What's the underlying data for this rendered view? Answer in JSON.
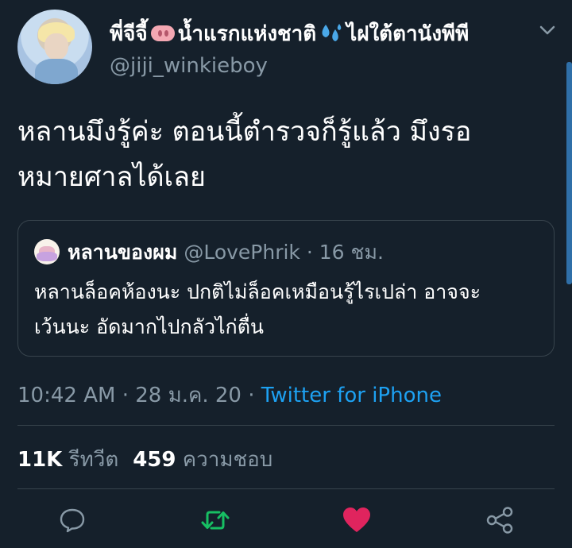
{
  "author": {
    "name_part1": "พี่จีจี้",
    "name_part2": "น้ำแรกแห่งชาติ",
    "name_part3": "ไฝใต้ตานังพีพี",
    "handle": "@jiji_winkieboy"
  },
  "tweet": {
    "text_line1": "หลานมึงรู้ค่ะ ตอนนี้ตำรวจก็รู้แล้ว มึงรอ",
    "text_line2": "หมายศาลได้เลย"
  },
  "quote": {
    "name": "หลานของผม",
    "handle": "@LovePhrik",
    "separator": "·",
    "time": "16 ชม.",
    "text_line1": "หลานล็อคห้องนะ ปกติไม่ล็อคเหมือนรู้ไรเปล่า อาจจะ",
    "text_line2": "เว้นนะ อัดมากไปกลัวไก่ตื่น"
  },
  "meta": {
    "time": "10:42 AM",
    "separator": "·",
    "date": "28 ม.ค. 20",
    "separator2": "·",
    "source": "Twitter for iPhone"
  },
  "stats": {
    "retweets_count": "11K",
    "retweets_label": "รีทวีต",
    "likes_count": "459",
    "likes_label": "ความชอบ"
  },
  "icons": {
    "reply": "speech-bubble-icon",
    "retweet": "retweet-icon",
    "like": "heart-icon",
    "share": "share-icon",
    "menu": "chevron-down-icon"
  },
  "colors": {
    "background": "#15202b",
    "accent": "#1da1f2",
    "retweet_active": "#17bf63",
    "like_active": "#e0245e",
    "muted": "#8899a6"
  }
}
